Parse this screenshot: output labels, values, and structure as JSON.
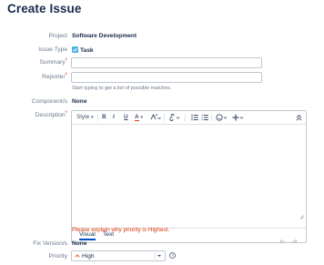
{
  "header": {
    "title": "Create Issue"
  },
  "form": {
    "project": {
      "label": "Project",
      "value": "Software Development"
    },
    "issue_type": {
      "label": "Issue Type",
      "value": "Task",
      "icon": "task-checkbox-icon",
      "color": "#4bade8"
    },
    "summary": {
      "label": "Summary",
      "required_mark": "*",
      "value": ""
    },
    "reporter": {
      "label": "Reporter",
      "required_mark": "*",
      "value": "",
      "hint": "Start typing to get a list of possible matches."
    },
    "components": {
      "label": "Component/s",
      "value": "None"
    },
    "description": {
      "label": "Description",
      "required_mark": "*",
      "toolbar": {
        "style_label": "Style",
        "bold": "B",
        "italic": "I",
        "underline": "U",
        "text_color": "A"
      },
      "tabs": {
        "visual": "Visual",
        "text": "Text"
      },
      "error": "Please explain why priority is Highest."
    },
    "fix_versions": {
      "label": "Fix Version/s",
      "value": "None"
    },
    "priority": {
      "label": "Priority",
      "value": "High",
      "color": "#f15c3c"
    }
  },
  "colors": {
    "accent": "#0052cc",
    "error": "#de350b",
    "label": "#6b778c"
  }
}
